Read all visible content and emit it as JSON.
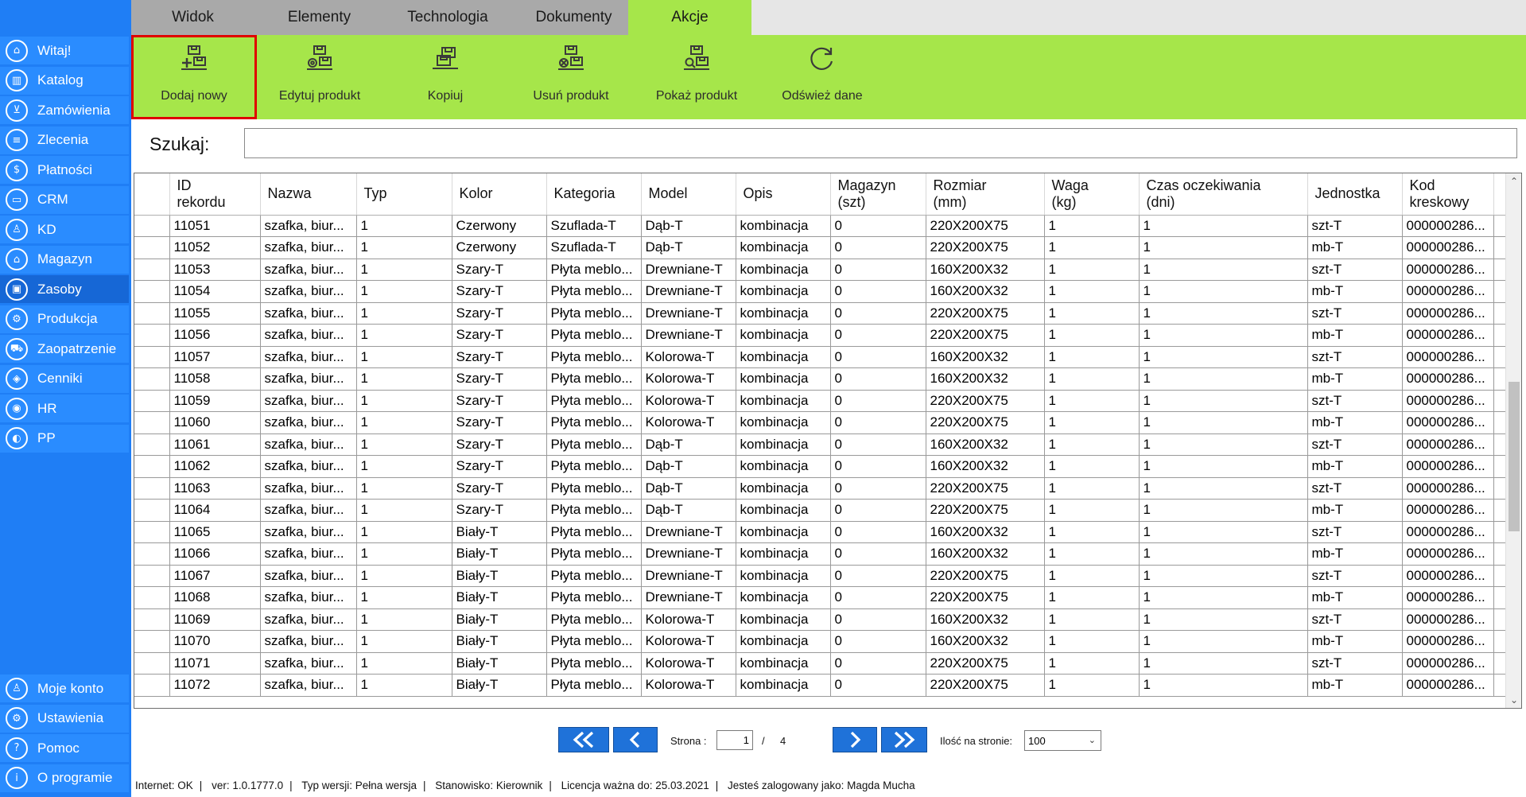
{
  "sidebar": {
    "top_items": [
      {
        "label": "Witaj!",
        "icon": "home-icon",
        "glyph": "⌂"
      },
      {
        "label": "Katalog",
        "icon": "book-icon",
        "glyph": "▥"
      },
      {
        "label": "Zamówienia",
        "icon": "cart-icon",
        "glyph": "⊻"
      },
      {
        "label": "Zlecenia",
        "icon": "list-icon",
        "glyph": "≡"
      },
      {
        "label": "Płatności",
        "icon": "dollar-icon",
        "glyph": "$"
      },
      {
        "label": "CRM",
        "icon": "crm-icon",
        "glyph": "▭"
      },
      {
        "label": "KD",
        "icon": "person-icon",
        "glyph": "♙"
      },
      {
        "label": "Magazyn",
        "icon": "warehouse-icon",
        "glyph": "⌂"
      },
      {
        "label": "Zasoby",
        "icon": "resources-icon",
        "glyph": "▣"
      },
      {
        "label": "Produkcja",
        "icon": "production-icon",
        "glyph": "⚙"
      },
      {
        "label": "Zaopatrzenie",
        "icon": "truck-icon",
        "glyph": "⛟"
      },
      {
        "label": "Cenniki",
        "icon": "tag-icon",
        "glyph": "◈"
      },
      {
        "label": "HR",
        "icon": "hr-icon",
        "glyph": "◉"
      },
      {
        "label": "PP",
        "icon": "pp-icon",
        "glyph": "◐"
      }
    ],
    "active_index": 8,
    "bottom_items": [
      {
        "label": "Moje konto",
        "icon": "account-icon",
        "glyph": "♙"
      },
      {
        "label": "Ustawienia",
        "icon": "settings-icon",
        "glyph": "⚙"
      },
      {
        "label": "Pomoc",
        "icon": "help-icon",
        "glyph": "?"
      },
      {
        "label": "O programie",
        "icon": "info-icon",
        "glyph": "i"
      }
    ]
  },
  "tabs": [
    {
      "label": "Widok"
    },
    {
      "label": "Elementy"
    },
    {
      "label": "Technologia"
    },
    {
      "label": "Dokumenty"
    },
    {
      "label": "Akcje"
    }
  ],
  "active_tab": "Akcje",
  "ribbon": {
    "add_new": "Dodaj nowy",
    "edit_product": "Edytuj produkt",
    "copy": "Kopiuj",
    "delete_product": "Usuń produkt",
    "show_product": "Pokaż produkt",
    "refresh": "Odśwież dane"
  },
  "search": {
    "label": "Szukaj:",
    "value": ""
  },
  "table": {
    "headers": [
      "ID\nrekordu",
      "Nazwa",
      "Typ",
      "Kolor",
      "Kategoria",
      "Model",
      "Opis",
      "Magazyn\n(szt)",
      "Rozmiar\n(mm)",
      "Waga\n(kg)",
      "Czas oczekiwania\n(dni)",
      "Jednostka",
      "Kod\nkreskowy"
    ],
    "rows": [
      [
        "11051",
        "szafka, biur...",
        "1",
        "Czerwony",
        "Szuflada-T",
        "Dąb-T",
        "kombinacja",
        "0",
        "220X200X75",
        "1",
        "1",
        "szt-T",
        "000000286..."
      ],
      [
        "11052",
        "szafka, biur...",
        "1",
        "Czerwony",
        "Szuflada-T",
        "Dąb-T",
        "kombinacja",
        "0",
        "220X200X75",
        "1",
        "1",
        "mb-T",
        "000000286..."
      ],
      [
        "11053",
        "szafka, biur...",
        "1",
        "Szary-T",
        "Płyta meblo...",
        "Drewniane-T",
        "kombinacja",
        "0",
        "160X200X32",
        "1",
        "1",
        "szt-T",
        "000000286..."
      ],
      [
        "11054",
        "szafka, biur...",
        "1",
        "Szary-T",
        "Płyta meblo...",
        "Drewniane-T",
        "kombinacja",
        "0",
        "160X200X32",
        "1",
        "1",
        "mb-T",
        "000000286..."
      ],
      [
        "11055",
        "szafka, biur...",
        "1",
        "Szary-T",
        "Płyta meblo...",
        "Drewniane-T",
        "kombinacja",
        "0",
        "220X200X75",
        "1",
        "1",
        "szt-T",
        "000000286..."
      ],
      [
        "11056",
        "szafka, biur...",
        "1",
        "Szary-T",
        "Płyta meblo...",
        "Drewniane-T",
        "kombinacja",
        "0",
        "220X200X75",
        "1",
        "1",
        "mb-T",
        "000000286..."
      ],
      [
        "11057",
        "szafka, biur...",
        "1",
        "Szary-T",
        "Płyta meblo...",
        "Kolorowa-T",
        "kombinacja",
        "0",
        "160X200X32",
        "1",
        "1",
        "szt-T",
        "000000286..."
      ],
      [
        "11058",
        "szafka, biur...",
        "1",
        "Szary-T",
        "Płyta meblo...",
        "Kolorowa-T",
        "kombinacja",
        "0",
        "160X200X32",
        "1",
        "1",
        "mb-T",
        "000000286..."
      ],
      [
        "11059",
        "szafka, biur...",
        "1",
        "Szary-T",
        "Płyta meblo...",
        "Kolorowa-T",
        "kombinacja",
        "0",
        "220X200X75",
        "1",
        "1",
        "szt-T",
        "000000286..."
      ],
      [
        "11060",
        "szafka, biur...",
        "1",
        "Szary-T",
        "Płyta meblo...",
        "Kolorowa-T",
        "kombinacja",
        "0",
        "220X200X75",
        "1",
        "1",
        "mb-T",
        "000000286..."
      ],
      [
        "11061",
        "szafka, biur...",
        "1",
        "Szary-T",
        "Płyta meblo...",
        "Dąb-T",
        "kombinacja",
        "0",
        "160X200X32",
        "1",
        "1",
        "szt-T",
        "000000286..."
      ],
      [
        "11062",
        "szafka, biur...",
        "1",
        "Szary-T",
        "Płyta meblo...",
        "Dąb-T",
        "kombinacja",
        "0",
        "160X200X32",
        "1",
        "1",
        "mb-T",
        "000000286..."
      ],
      [
        "11063",
        "szafka, biur...",
        "1",
        "Szary-T",
        "Płyta meblo...",
        "Dąb-T",
        "kombinacja",
        "0",
        "220X200X75",
        "1",
        "1",
        "szt-T",
        "000000286..."
      ],
      [
        "11064",
        "szafka, biur...",
        "1",
        "Szary-T",
        "Płyta meblo...",
        "Dąb-T",
        "kombinacja",
        "0",
        "220X200X75",
        "1",
        "1",
        "mb-T",
        "000000286..."
      ],
      [
        "11065",
        "szafka, biur...",
        "1",
        "Biały-T",
        "Płyta meblo...",
        "Drewniane-T",
        "kombinacja",
        "0",
        "160X200X32",
        "1",
        "1",
        "szt-T",
        "000000286..."
      ],
      [
        "11066",
        "szafka, biur...",
        "1",
        "Biały-T",
        "Płyta meblo...",
        "Drewniane-T",
        "kombinacja",
        "0",
        "160X200X32",
        "1",
        "1",
        "mb-T",
        "000000286..."
      ],
      [
        "11067",
        "szafka, biur...",
        "1",
        "Biały-T",
        "Płyta meblo...",
        "Drewniane-T",
        "kombinacja",
        "0",
        "220X200X75",
        "1",
        "1",
        "szt-T",
        "000000286..."
      ],
      [
        "11068",
        "szafka, biur...",
        "1",
        "Biały-T",
        "Płyta meblo...",
        "Drewniane-T",
        "kombinacja",
        "0",
        "220X200X75",
        "1",
        "1",
        "mb-T",
        "000000286..."
      ],
      [
        "11069",
        "szafka, biur...",
        "1",
        "Biały-T",
        "Płyta meblo...",
        "Kolorowa-T",
        "kombinacja",
        "0",
        "160X200X32",
        "1",
        "1",
        "szt-T",
        "000000286..."
      ],
      [
        "11070",
        "szafka, biur...",
        "1",
        "Biały-T",
        "Płyta meblo...",
        "Kolorowa-T",
        "kombinacja",
        "0",
        "160X200X32",
        "1",
        "1",
        "mb-T",
        "000000286..."
      ],
      [
        "11071",
        "szafka, biur...",
        "1",
        "Biały-T",
        "Płyta meblo...",
        "Kolorowa-T",
        "kombinacja",
        "0",
        "220X200X75",
        "1",
        "1",
        "szt-T",
        "000000286..."
      ],
      [
        "11072",
        "szafka, biur...",
        "1",
        "Biały-T",
        "Płyta meblo...",
        "Kolorowa-T",
        "kombinacja",
        "0",
        "220X200X75",
        "1",
        "1",
        "mb-T",
        "000000286..."
      ]
    ]
  },
  "pager": {
    "page_label": "Strona :",
    "current_page": "1",
    "slash": "/",
    "total_pages": "4",
    "per_page_label": "Ilość na stronie:",
    "per_page_value": "100"
  },
  "status": {
    "internet": "Internet: OK",
    "version": "ver: 1.0.1777.0",
    "version_type": "Typ wersji: Pełna wersja",
    "station": "Stanowisko: Kierownik",
    "license": "Licencja ważna do: 25.03.2021",
    "user": "Jesteś zalogowany jako: Magda Mucha"
  },
  "colors": {
    "sidebar": "#1f7ef5",
    "accent_green": "#a6e64a",
    "selected_border": "#e00000",
    "pager_button": "#1f72d9"
  }
}
